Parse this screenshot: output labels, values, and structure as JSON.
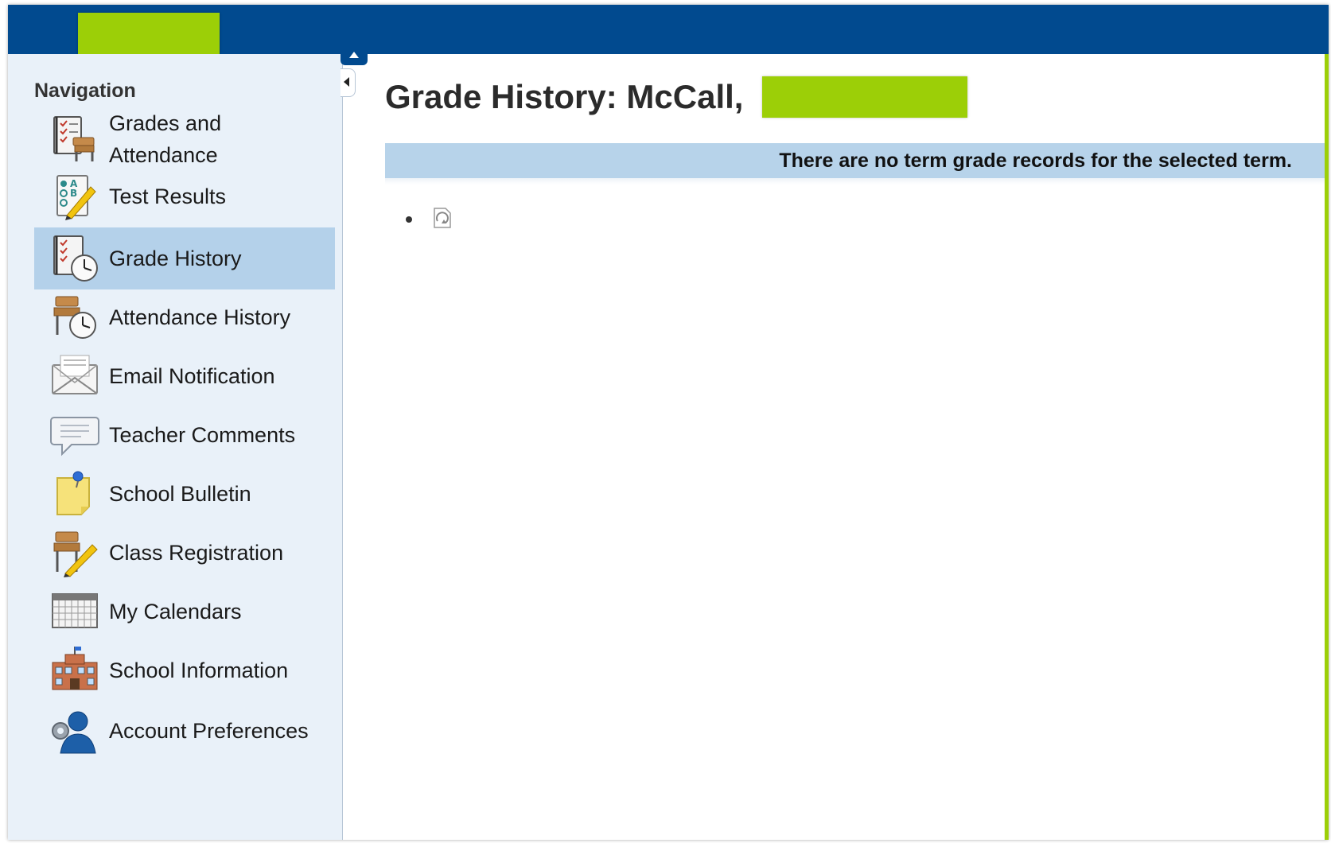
{
  "sidebar": {
    "heading": "Navigation",
    "items": [
      {
        "label_line1": "Grades and",
        "label_line2": "Attendance",
        "icon": "grades-attendance-icon"
      },
      {
        "label": "Test Results",
        "icon": "test-results-icon"
      },
      {
        "label": "Grade History",
        "icon": "grade-history-icon",
        "selected": true
      },
      {
        "label": "Attendance History",
        "icon": "attendance-history-icon"
      },
      {
        "label": "Email Notification",
        "icon": "email-envelope-icon"
      },
      {
        "label": "Teacher Comments",
        "icon": "speech-bubble-icon"
      },
      {
        "label": "School Bulletin",
        "icon": "bulletin-note-icon"
      },
      {
        "label": "Class Registration",
        "icon": "class-registration-icon"
      },
      {
        "label": "My Calendars",
        "icon": "calendar-icon"
      },
      {
        "label": "School Information",
        "icon": "school-building-icon"
      },
      {
        "label": "Account Preferences",
        "icon": "user-gear-icon"
      }
    ]
  },
  "main": {
    "title": "Grade History: McCall,",
    "notice": "There are no term grade records for the selected term."
  },
  "colors": {
    "header": "#014a8f",
    "sidebar_bg": "#e9f1f9",
    "selected_bg": "#b4d1ea",
    "notice_bg": "#b7d3ea",
    "redaction": "#9ccf07"
  }
}
